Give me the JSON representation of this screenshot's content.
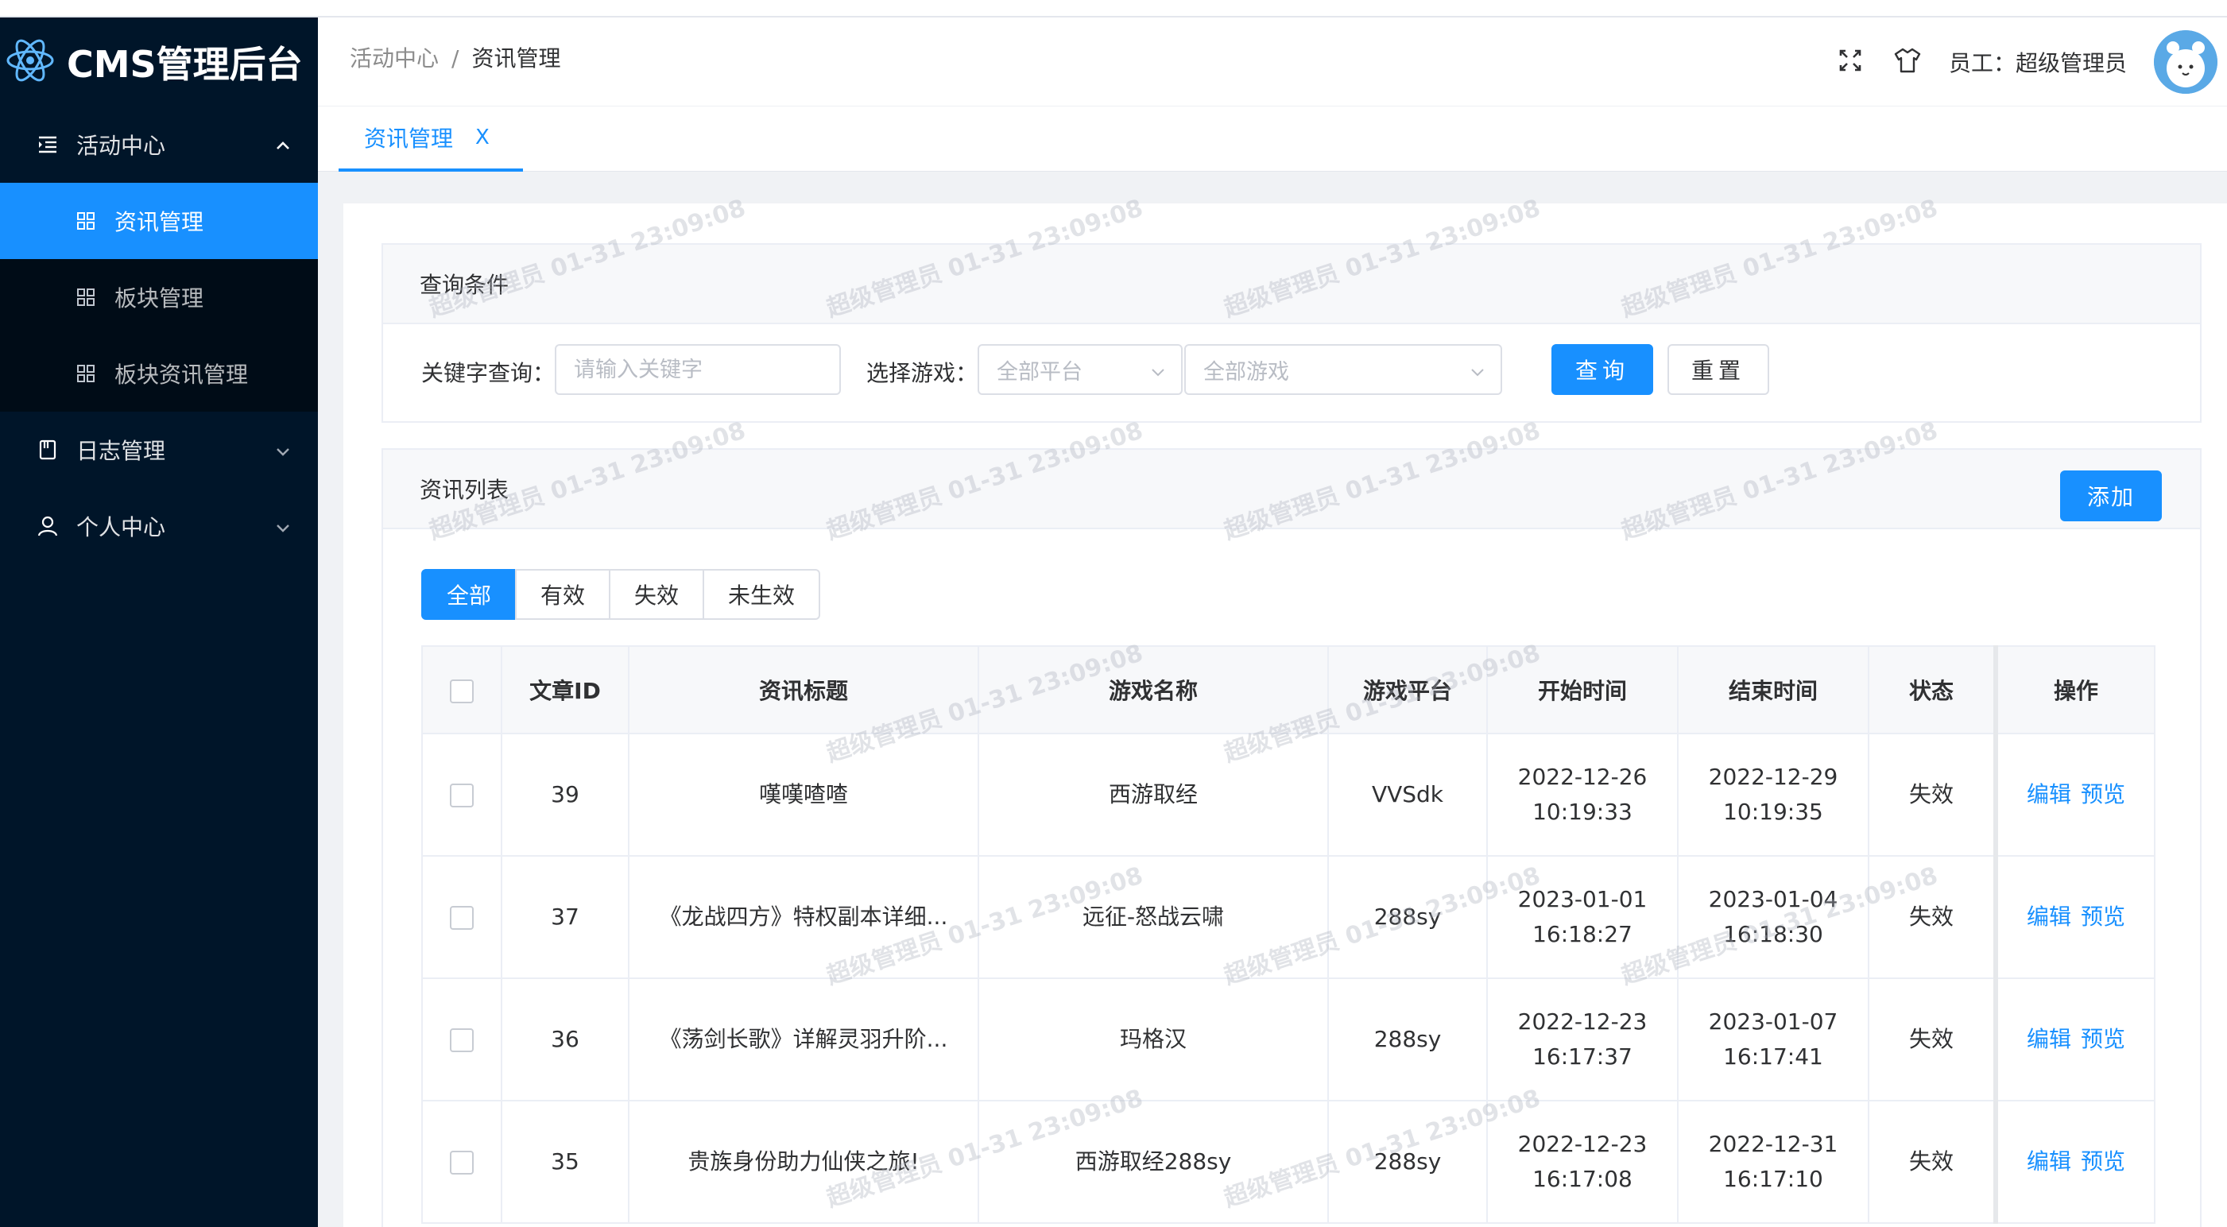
{
  "app": {
    "title": "CMS管理后台"
  },
  "sidebar": {
    "items": [
      {
        "label": "活动中心",
        "icon": "list-indent-icon",
        "expanded": true,
        "children": [
          {
            "label": "资讯管理",
            "icon": "grid-icon",
            "active": true
          },
          {
            "label": "板块管理",
            "icon": "grid-icon"
          },
          {
            "label": "板块资讯管理",
            "icon": "grid-icon"
          }
        ]
      },
      {
        "label": "日志管理",
        "icon": "book-icon",
        "expanded": false
      },
      {
        "label": "个人中心",
        "icon": "user-icon",
        "expanded": false
      }
    ]
  },
  "header": {
    "breadcrumb": [
      "活动中心",
      "资讯管理"
    ],
    "breadcrumb_sep": "/",
    "user_label": "员工：超级管理员",
    "icons": [
      "fullscreen-icon",
      "shirt-icon"
    ]
  },
  "tabs": [
    {
      "label": "资讯管理",
      "close": "X"
    }
  ],
  "query": {
    "title": "查询条件",
    "keyword_label": "关键字查询：",
    "keyword_placeholder": "请输入关键字",
    "keyword_value": "",
    "game_label": "选择游戏：",
    "platform_select": "全部平台",
    "game_select": "全部游戏",
    "search_button": "查询",
    "reset_button": "重置"
  },
  "list": {
    "title": "资讯列表",
    "add_button": "添加",
    "filters": [
      "全部",
      "有效",
      "失效",
      "未生效"
    ],
    "active_filter": "全部",
    "columns": [
      "文章ID",
      "资讯标题",
      "游戏名称",
      "游戏平台",
      "开始时间",
      "结束时间",
      "状态",
      "操作"
    ],
    "rows": [
      {
        "id": "39",
        "title": "嘆嘆喳喳",
        "game": "西游取经",
        "platform": "VVSdk",
        "start_date": "2022-12-26",
        "start_time": "10:19:33",
        "end_date": "2022-12-29",
        "end_time": "10:19:35",
        "status": "失效"
      },
      {
        "id": "37",
        "title": "《龙战四方》特权副本详细...",
        "game": "远征-怒战云啸",
        "platform": "288sy",
        "start_date": "2023-01-01",
        "start_time": "16:18:27",
        "end_date": "2023-01-04",
        "end_time": "16:18:30",
        "status": "失效"
      },
      {
        "id": "36",
        "title": "《荡剑长歌》详解灵羽升阶...",
        "game": "玛格汉",
        "platform": "288sy",
        "start_date": "2022-12-23",
        "start_time": "16:17:37",
        "end_date": "2023-01-07",
        "end_time": "16:17:41",
        "status": "失效"
      },
      {
        "id": "35",
        "title": "贵族身份助力仙侠之旅!",
        "game": "西游取经288sy",
        "platform": "288sy",
        "start_date": "2022-12-23",
        "start_time": "16:17:08",
        "end_date": "2022-12-31",
        "end_time": "16:17:10",
        "status": "失效"
      }
    ],
    "actions": [
      "编辑",
      "预览"
    ]
  },
  "watermark": "超级管理员 01-31 23:09:08",
  "colors": {
    "sidebar_bg": "#001529",
    "submenu_bg": "#000c17",
    "primary": "#1890ff",
    "content_bg": "#f0f2f5"
  }
}
